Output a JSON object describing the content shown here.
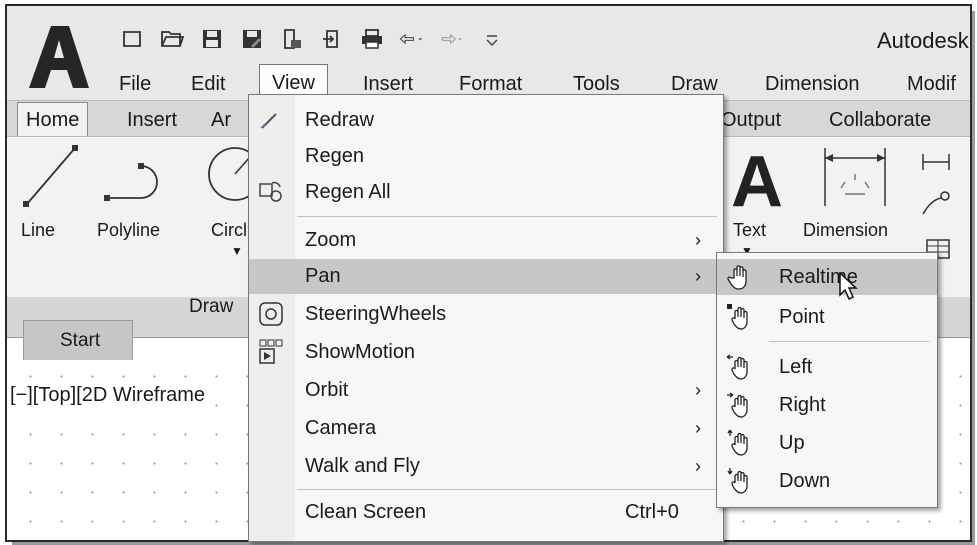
{
  "app": {
    "title": "Autodesk"
  },
  "menubar": {
    "items": [
      "File",
      "Edit",
      "View",
      "Insert",
      "Format",
      "Tools",
      "Draw",
      "Dimension",
      "Modif"
    ],
    "active": "View"
  },
  "ribbon": {
    "tabs": [
      "Home",
      "Insert",
      "Ar",
      "Output",
      "Collaborate"
    ],
    "tools": [
      "Line",
      "Polyline",
      "Circl",
      "Text",
      "Dimension"
    ],
    "panel_label": "Draw"
  },
  "file_tab": "Start",
  "viewport_label": "[−][Top][2D Wireframe",
  "view_menu": {
    "items": [
      {
        "label": "Redraw",
        "icon": "redraw-icon"
      },
      {
        "label": "Regen"
      },
      {
        "label": "Regen All",
        "icon": "regen-all-icon"
      },
      {
        "label": "Zoom",
        "submenu": "›"
      },
      {
        "label": "Pan",
        "submenu": "›",
        "highlighted": true
      },
      {
        "label": "SteeringWheels",
        "icon": "steering-wheel-icon"
      },
      {
        "label": "ShowMotion",
        "icon": "showmotion-icon"
      },
      {
        "label": "Orbit",
        "submenu": "›"
      },
      {
        "label": "Camera",
        "submenu": "›"
      },
      {
        "label": "Walk and Fly",
        "submenu": "›"
      },
      {
        "label": "Clean Screen",
        "shortcut": "Ctrl+0"
      }
    ]
  },
  "pan_submenu": {
    "items": [
      {
        "label": "Realtime",
        "icon": "pan-hand-icon",
        "highlighted": true
      },
      {
        "label": "Point",
        "icon": "pan-point-icon"
      },
      {
        "label": "Left",
        "icon": "pan-left-icon"
      },
      {
        "label": "Right",
        "icon": "pan-right-icon"
      },
      {
        "label": "Up",
        "icon": "pan-up-icon"
      },
      {
        "label": "Down",
        "icon": "pan-down-icon"
      }
    ]
  },
  "colors": {
    "menu_highlight": "#c7c7c7",
    "chrome": "#e8e8e8",
    "ribbon": "#f2f2f2"
  }
}
